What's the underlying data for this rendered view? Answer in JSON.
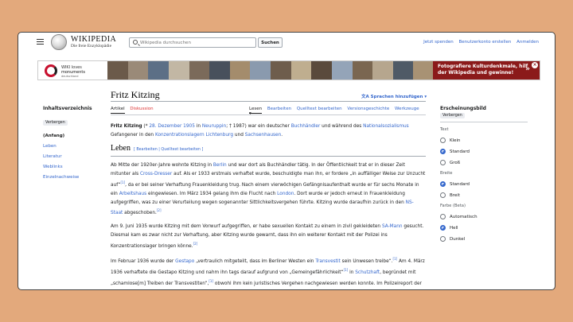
{
  "header": {
    "wordmark": "WIKIPEDIA",
    "tagline": "Die freie Enzyklopädie",
    "search_placeholder": "Wikipedia durchsuchen",
    "search_button": "Suchen",
    "user_links": [
      "Jetzt spenden",
      "Benutzerkonto erstellen",
      "Anmelden"
    ]
  },
  "banner": {
    "logo_line1": "WIKI loves",
    "logo_line2": "monuments",
    "logo_line3": "deutschland",
    "cta": "Fotografiere Kulturdenkmale, hilf der Wikipedia und gewinne!",
    "arrow": "»",
    "close": "×",
    "photo_colors": [
      "#6b5a4a",
      "#9a8a78",
      "#5c6f86",
      "#c2b7a4",
      "#7b6a5a",
      "#48505c",
      "#a48c6c",
      "#8a9aae",
      "#6e5d4c",
      "#bfae8f",
      "#5a4a3c",
      "#94a4b8",
      "#7a6650",
      "#b6a68e",
      "#4f5a66",
      "#a89274"
    ]
  },
  "toc": {
    "title": "Inhaltsverzeichnis",
    "hide": "Verbergen",
    "items": [
      "(Anfang)",
      "Leben",
      "Literatur",
      "Weblinks",
      "Einzelnachweise"
    ]
  },
  "article": {
    "title": "Fritz Kitzing",
    "lang_button": "Sprachen hinzufügen",
    "tabs_left": [
      "Artikel",
      "Diskussion"
    ],
    "tabs_right": [
      "Lesen",
      "Bearbeiten",
      "Quelltext bearbeiten",
      "Versionsgeschichte",
      "Werkzeuge"
    ],
    "section_leben": "Leben",
    "edit": "[ Bearbeiten | Quelltext bearbeiten ]"
  },
  "appearance": {
    "title": "Erscheinungsbild",
    "hide": "Verbergen",
    "groups": [
      {
        "label": "Text",
        "options": [
          "Klein",
          "Standard",
          "Groß"
        ],
        "selected": 1
      },
      {
        "label": "Breite",
        "options": [
          "Standard",
          "Breit"
        ],
        "selected": 0
      },
      {
        "label": "Farbe (Beta)",
        "options": [
          "Automatisch",
          "Hell",
          "Dunkel"
        ],
        "selected": 1
      }
    ]
  },
  "colors": {
    "link": "#3366cc",
    "red_link": "#dd3333",
    "banner_red": "#8b1a1a"
  }
}
